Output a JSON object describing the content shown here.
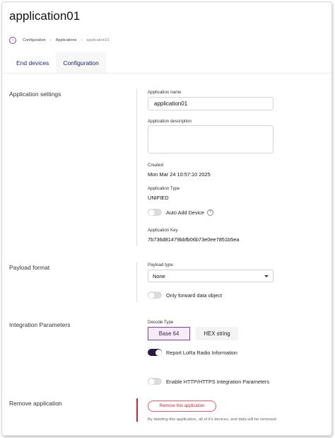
{
  "page": {
    "title": "application01"
  },
  "breadcrumbs": [
    "Configuration",
    "Applications",
    "application01"
  ],
  "tabs": [
    {
      "label": "End devices",
      "active": false
    },
    {
      "label": "Configuration",
      "active": true
    }
  ],
  "sections": {
    "application_settings": {
      "title": "Application settings",
      "name_label": "Application name",
      "name_value": "application01",
      "description_label": "Application description",
      "description_value": "",
      "created_label": "Created",
      "created_value": "Mon Mar 24 10:57:10 2025",
      "type_label": "Application Type",
      "type_value": "UNIFIED",
      "auto_add_label": "Auto Add Device",
      "auto_add_on": false,
      "key_label": "Application Key",
      "key_value": "7b736d81479bbfb06b73e0ee7851b5ea"
    },
    "payload_format": {
      "title": "Payload format",
      "type_label": "Payload type",
      "type_value": "None",
      "only_forward_label": "Only forward data object",
      "only_forward_on": false
    },
    "integration": {
      "title": "Integration Parameters",
      "decode_label": "Decode Type",
      "decode_options": [
        "Base 64",
        "HEX string"
      ],
      "decode_selected": "Base 64",
      "report_lora_label": "Report LoRa Radio Information",
      "report_lora_on": true,
      "enable_http_label": "Enable HTTP/HTTPS Integration Parameters",
      "enable_http_on": false
    },
    "remove": {
      "title": "Remove application",
      "button_label": "Remove this application",
      "note": "By deleting this application, all of it's devices, and data will be removed."
    }
  },
  "colors": {
    "accent": "#8a3ca6",
    "toggle_on": "#2c1b3f",
    "danger": "#d8202f"
  }
}
